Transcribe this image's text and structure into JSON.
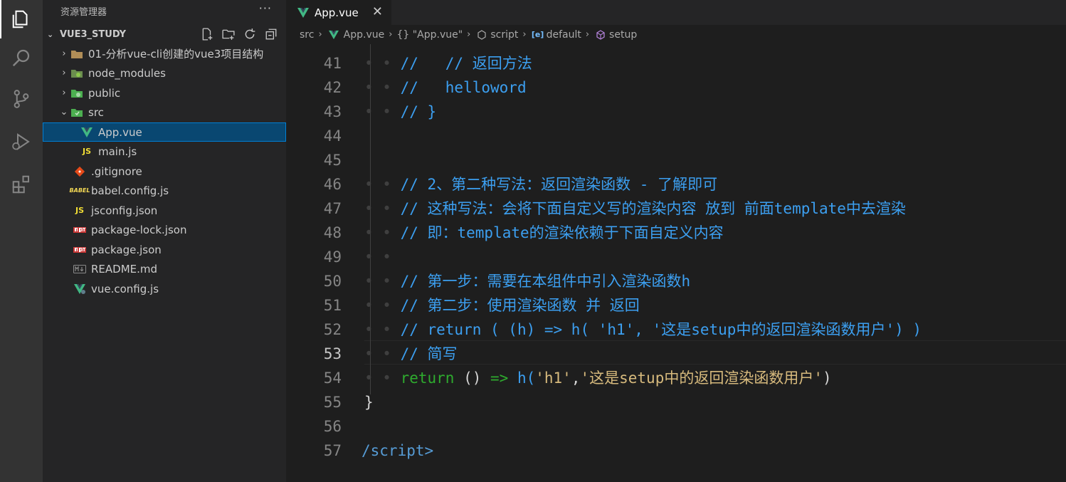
{
  "sidebar": {
    "title": "资源管理器",
    "more": "···",
    "project": "VUE3_STUDY",
    "items": [
      {
        "label": "01-分析vue-cli创建的vue3项目结构",
        "icon": "folder-icon",
        "expanded": false
      },
      {
        "label": "node_modules",
        "icon": "node-folder-icon",
        "expanded": false
      },
      {
        "label": "public",
        "icon": "public-folder-icon",
        "expanded": false
      },
      {
        "label": "src",
        "icon": "src-folder-icon",
        "expanded": true
      },
      {
        "label": "App.vue",
        "icon": "vue-file-icon",
        "selected": true
      },
      {
        "label": "main.js",
        "icon": "js-file-icon"
      },
      {
        "label": ".gitignore",
        "icon": "git-icon"
      },
      {
        "label": "babel.config.js",
        "icon": "babel-icon"
      },
      {
        "label": "jsconfig.json",
        "icon": "js-file-icon"
      },
      {
        "label": "package-lock.json",
        "icon": "npm-icon"
      },
      {
        "label": "package.json",
        "icon": "npm-icon"
      },
      {
        "label": "README.md",
        "icon": "markdown-icon"
      },
      {
        "label": "vue.config.js",
        "icon": "vue-config-icon"
      }
    ]
  },
  "tab": {
    "label": "App.vue",
    "close": "✕"
  },
  "breadcrumb": {
    "src": "src",
    "file": "App.vue",
    "block": "{} \"App.vue\"",
    "script": "script",
    "default": "default",
    "setup": "setup"
  },
  "editor": {
    "current_line": 53,
    "lines": [
      {
        "n": "41",
        "ws": "• • ",
        "text": "//   // 返回方法"
      },
      {
        "n": "42",
        "ws": "• • ",
        "text": "//   helloword"
      },
      {
        "n": "43",
        "ws": "• • ",
        "text": "// }"
      },
      {
        "n": "44",
        "ws": "",
        "text": ""
      },
      {
        "n": "45",
        "ws": "",
        "text": ""
      },
      {
        "n": "46",
        "ws": "• • ",
        "text": "// 2、第二种写法：返回渲染函数 - 了解即可"
      },
      {
        "n": "47",
        "ws": "• • ",
        "text": "// 这种写法：会将下面自定义写的渲染内容 放到 前面template中去渲染"
      },
      {
        "n": "48",
        "ws": "• • ",
        "text": "// 即：template的渲染依赖于下面自定义内容"
      },
      {
        "n": "49",
        "ws": "• • ",
        "text": ""
      },
      {
        "n": "50",
        "ws": "• • ",
        "text": "// 第一步：需要在本组件中引入渲染函数h"
      },
      {
        "n": "51",
        "ws": "• • ",
        "text": "// 第二步：使用渲染函数 并 返回"
      },
      {
        "n": "52",
        "ws": "• • ",
        "text": "// return ( (h) => h( 'h1', '这是setup中的返回渲染函数用户') )"
      },
      {
        "n": "53",
        "ws": "• • ",
        "text": "// 简写"
      },
      {
        "n": "54",
        "ws": "• • ",
        "tokens": {
          "kw": "return",
          "mid": " () ",
          "arrow": "=>",
          "fn": " h(",
          "str1": "'h1'",
          "comma": ",",
          "str2": "'这是setup中的返回渲染函数用户'",
          "close": ")"
        }
      },
      {
        "n": "55",
        "ws": "",
        "text": "}"
      },
      {
        "n": "56",
        "ws": "",
        "text": ""
      },
      {
        "n": "57",
        "ws": "",
        "text": "/script>"
      }
    ]
  }
}
